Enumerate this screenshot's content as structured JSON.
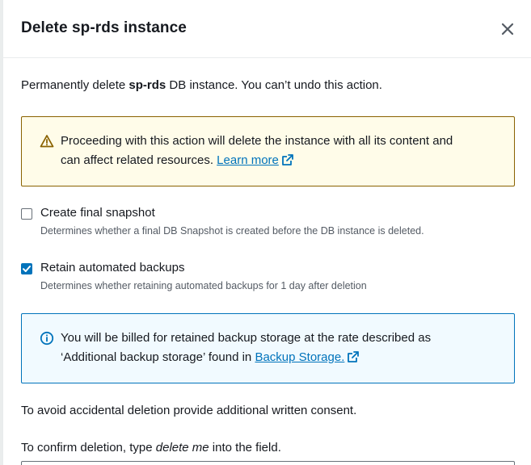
{
  "modal": {
    "title": "Delete sp-rds instance",
    "close_icon": "close-icon"
  },
  "intro": {
    "prefix": "Permanently delete ",
    "instance": "sp-rds",
    "suffix": " DB instance. You can’t undo this action."
  },
  "warning": {
    "icon": "warning-icon",
    "line1": "Proceeding with this action will delete the instance with all its content and",
    "line2": "can affect related resources. ",
    "link": "Learn more",
    "link_icon": "external-link-icon"
  },
  "options": [
    {
      "label": "Create final snapshot",
      "description": "Determines whether a final DB Snapshot is created before the DB instance is deleted.",
      "checked": false
    },
    {
      "label": "Retain automated backups",
      "description": "Determines whether retaining automated backups for 1 day after deletion",
      "checked": true
    }
  ],
  "info": {
    "icon": "info-icon",
    "line1": "You will be billed for retained backup storage at the rate described as",
    "line2": "‘Additional backup storage’ found in ",
    "link": "Backup Storage.",
    "link_icon": "external-link-icon"
  },
  "consent_text": "To avoid accidental deletion provide additional written consent.",
  "confirm": {
    "prefix": "To confirm deletion, type ",
    "phrase": "delete me",
    "suffix": " into the field.",
    "input_value": ""
  },
  "colors": {
    "accent": "#0073bb",
    "warning_border": "#8a6200",
    "warning_bg": "#fffce9",
    "info_bg": "#f1faff"
  }
}
